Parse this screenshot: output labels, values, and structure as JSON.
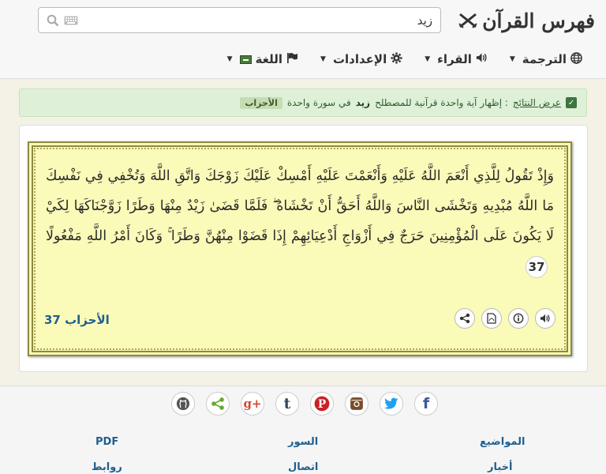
{
  "app": {
    "title": "فهرس القرآن"
  },
  "search": {
    "value": "زيد"
  },
  "nav": {
    "translation": "الترجمة",
    "reciter": "القراء",
    "settings": "الإعدادات",
    "language": "اللغة"
  },
  "alert": {
    "show_results": "عرض النتائج",
    "text_before": ": إظهار آية واحدة قرآنية للمصطلح",
    "term": "زيد",
    "text_after": "في سورة واحدة",
    "sura": "الأحزاب"
  },
  "verse": {
    "text": "وَإِذْ تَقُولُ لِلَّذِي أَنْعَمَ اللَّهُ عَلَيْهِ وَأَنْعَمْتَ عَلَيْهِ أَمْسِكْ عَلَيْكَ زَوْجَكَ وَاتَّقِ اللَّهَ وَتُخْفِي فِي نَفْسِكَ مَا اللَّهُ مُبْدِيهِ وَتَخْشَى النَّاسَ وَاللَّهُ أَحَقُّ أَنْ تَخْشَاهُ ۖ فَلَمَّا قَضَىٰ زَيْدٌ مِنْهَا وَطَرًا زَوَّجْنَاكَهَا لِكَيْ لَا يَكُونَ عَلَى الْمُؤْمِنِينَ حَرَجٌ فِي أَزْوَاجِ أَدْعِيَائِهِمْ إِذَا قَضَوْا مِنْهُنَّ وَطَرًا ۚ وَكَانَ أَمْرُ اللَّهِ مَفْعُولًا",
    "number": "37",
    "reference": "الأحزاب 37"
  },
  "footer": {
    "links": {
      "topics": "المواضيع",
      "suras": "السور",
      "pdf": "PDF",
      "news": "أخبار",
      "contact": "اتصال",
      "links": "روابط"
    }
  },
  "colors": {
    "verse_bg": "#fafab9",
    "link": "#1f5f8f",
    "alert_bg": "#dff0d8"
  }
}
